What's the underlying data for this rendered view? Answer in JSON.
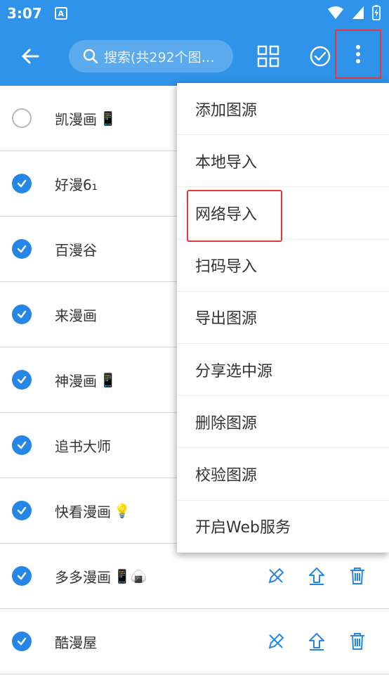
{
  "status": {
    "time": "3:07",
    "notif": "A"
  },
  "appbar": {
    "search_placeholder": "搜索(共292个图…"
  },
  "list": [
    {
      "name": "凯漫画",
      "emoji": "📱",
      "checked": false,
      "actions": false
    },
    {
      "name": "好漫6₁",
      "emoji": "",
      "checked": true,
      "actions": false
    },
    {
      "name": "百漫谷",
      "emoji": "",
      "checked": true,
      "actions": false
    },
    {
      "name": "来漫画",
      "emoji": "",
      "checked": true,
      "actions": false
    },
    {
      "name": "神漫画",
      "emoji": "📱",
      "checked": true,
      "actions": false
    },
    {
      "name": "追书大师",
      "emoji": "",
      "checked": true,
      "actions": false
    },
    {
      "name": "快看漫画",
      "emoji": "💡",
      "checked": true,
      "actions": false
    },
    {
      "name": "多多漫画",
      "emoji": "📱🍙",
      "checked": true,
      "actions": true
    },
    {
      "name": "酷漫屋",
      "emoji": "",
      "checked": true,
      "actions": true
    }
  ],
  "menu": [
    "添加图源",
    "本地导入",
    "网络导入",
    "扫码导入",
    "导出图源",
    "分享选中源",
    "删除图源",
    "校验图源",
    "开启Web服务"
  ],
  "colors": {
    "primary": "#2f93e9",
    "check": "#2686e6",
    "highlight_box": "#e8383d"
  }
}
